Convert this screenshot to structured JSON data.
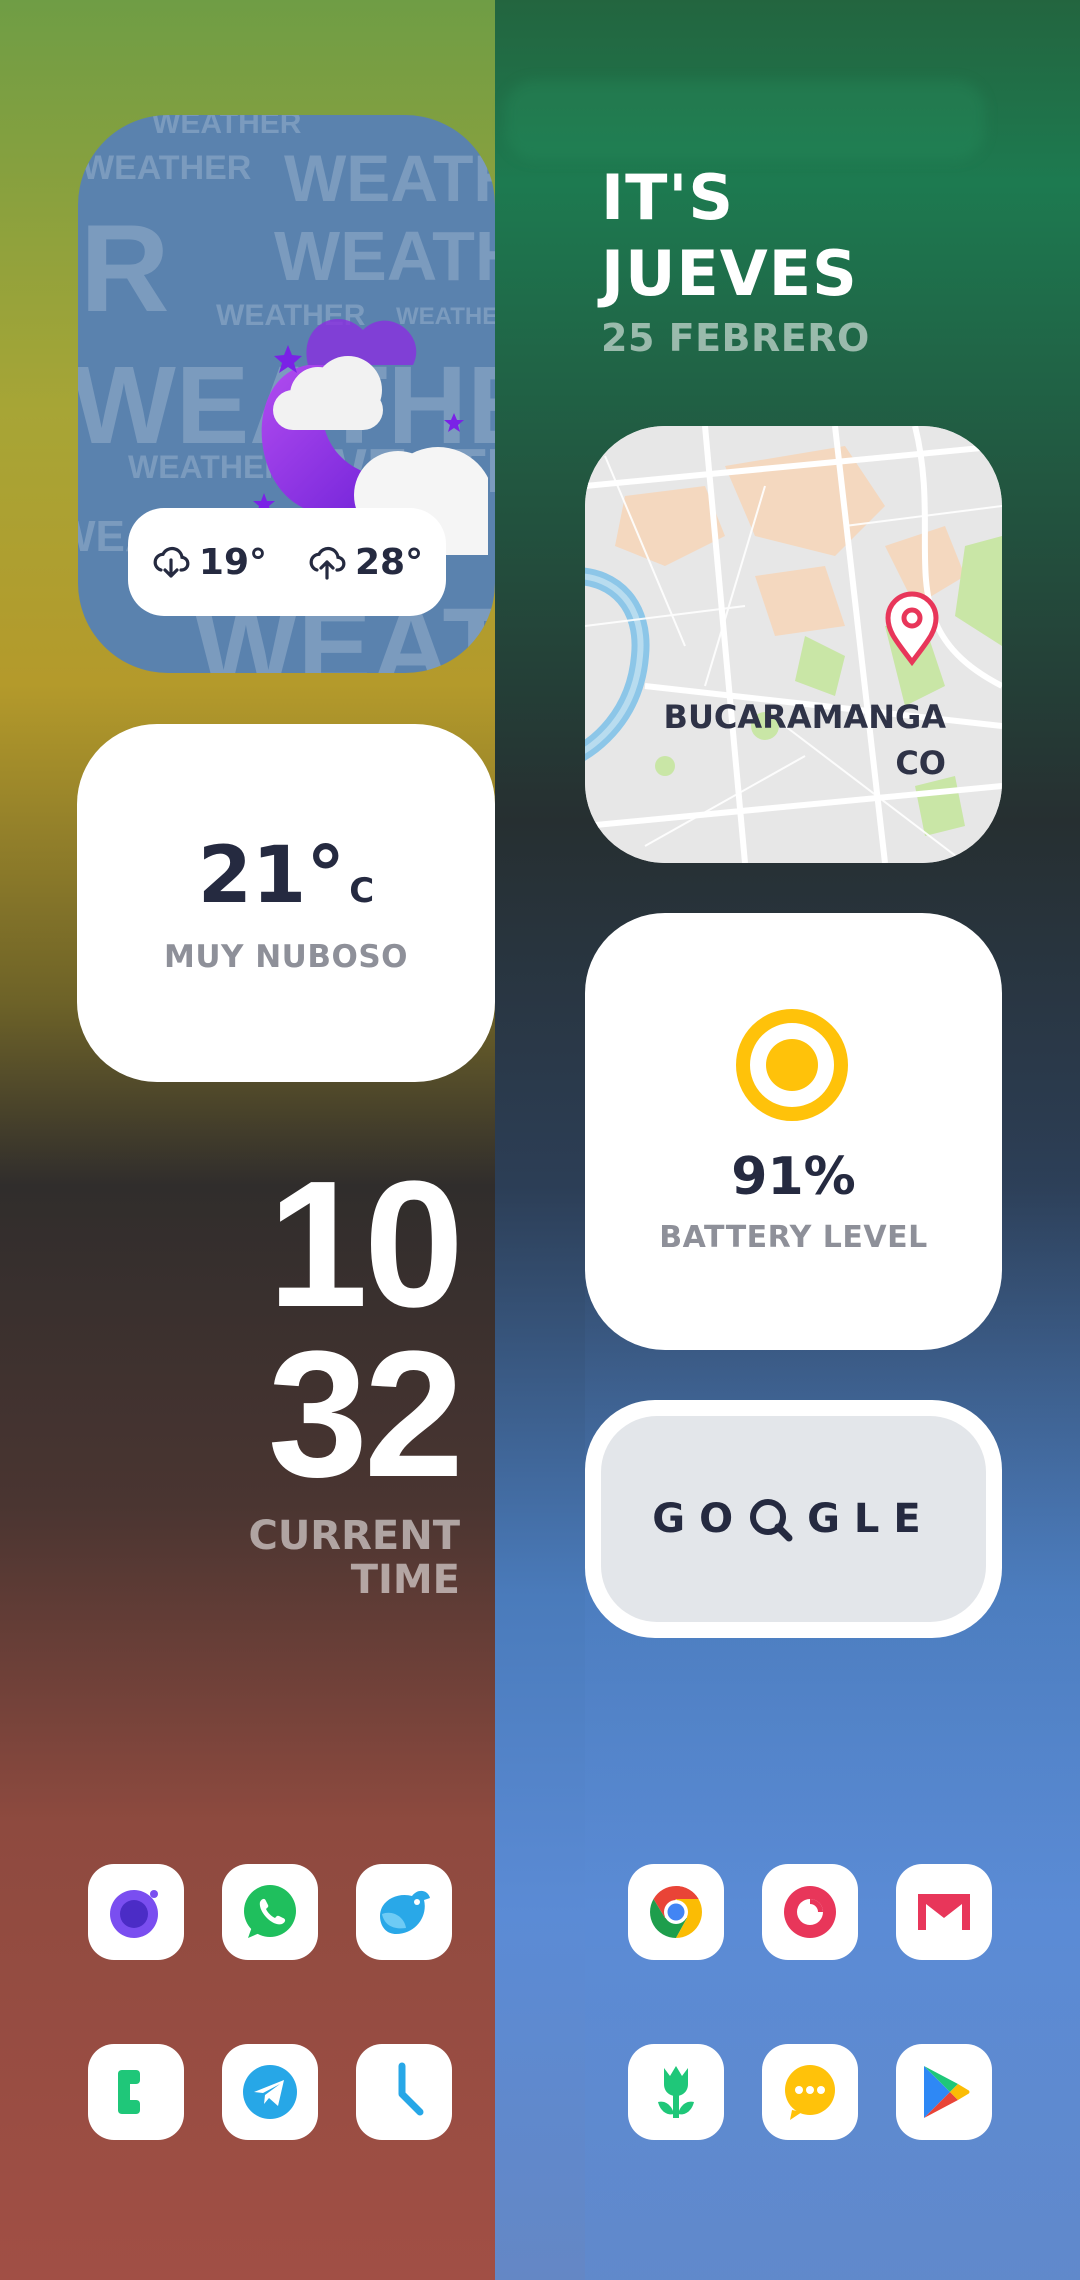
{
  "weather": {
    "watermark_word": "WEATHER",
    "low_temp": "19°",
    "high_temp": "28°"
  },
  "day": {
    "line1": "IT'S",
    "line2": "JUEVES",
    "date": "25 FEBRERO"
  },
  "location": {
    "city": "BUCARAMANGA",
    "country": "CO"
  },
  "conditions": {
    "temperature": "21°",
    "unit": "C",
    "description": "MUY NUBOSO"
  },
  "battery": {
    "percent": "91%",
    "label": "BATTERY LEVEL",
    "color": "#ffc20a"
  },
  "clock": {
    "hours": "10",
    "minutes": "32",
    "label_line1": "CURRENT",
    "label_line2": "TIME"
  },
  "search": {
    "text_before": "GO",
    "text_after": "GLE"
  },
  "apps": [
    {
      "icon": "camera-icon"
    },
    {
      "icon": "whatsapp-icon"
    },
    {
      "icon": "bird-icon"
    },
    {
      "icon": "chrome-icon"
    },
    {
      "icon": "music-icon"
    },
    {
      "icon": "gmail-icon"
    },
    {
      "icon": "phone-icon"
    },
    {
      "icon": "telegram-icon"
    },
    {
      "icon": "clock-icon"
    },
    {
      "icon": "flower-icon"
    },
    {
      "icon": "messages-icon"
    },
    {
      "icon": "play-store-icon"
    }
  ],
  "colors": {
    "text_dark": "#252a40",
    "text_gray": "#8e9099",
    "weather_bg": "#5a82ae"
  }
}
